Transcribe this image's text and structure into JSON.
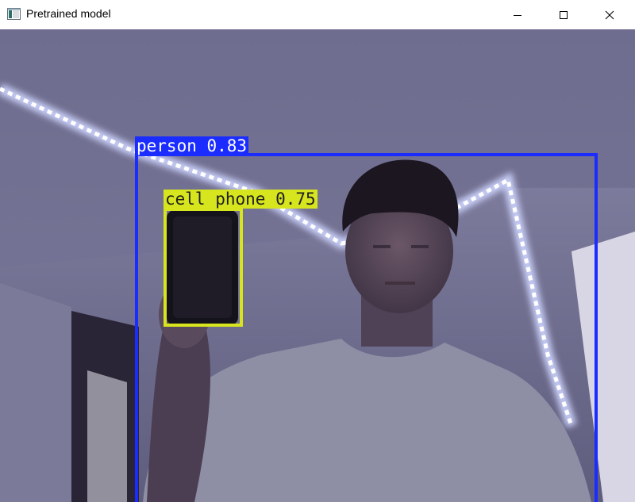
{
  "window": {
    "title": "Pretrained model",
    "app_icon": "app-window-icon",
    "controls": {
      "minimize_icon": "minimize-icon",
      "maximize_icon": "maximize-icon",
      "close_icon": "close-icon"
    }
  },
  "detections": [
    {
      "label": "person 0.83",
      "color": "#1a2cff",
      "label_text_color": "#ffffff"
    },
    {
      "label": "cell phone 0.75",
      "color": "#d7e51e",
      "label_text_color": "#1e1e1e"
    }
  ]
}
